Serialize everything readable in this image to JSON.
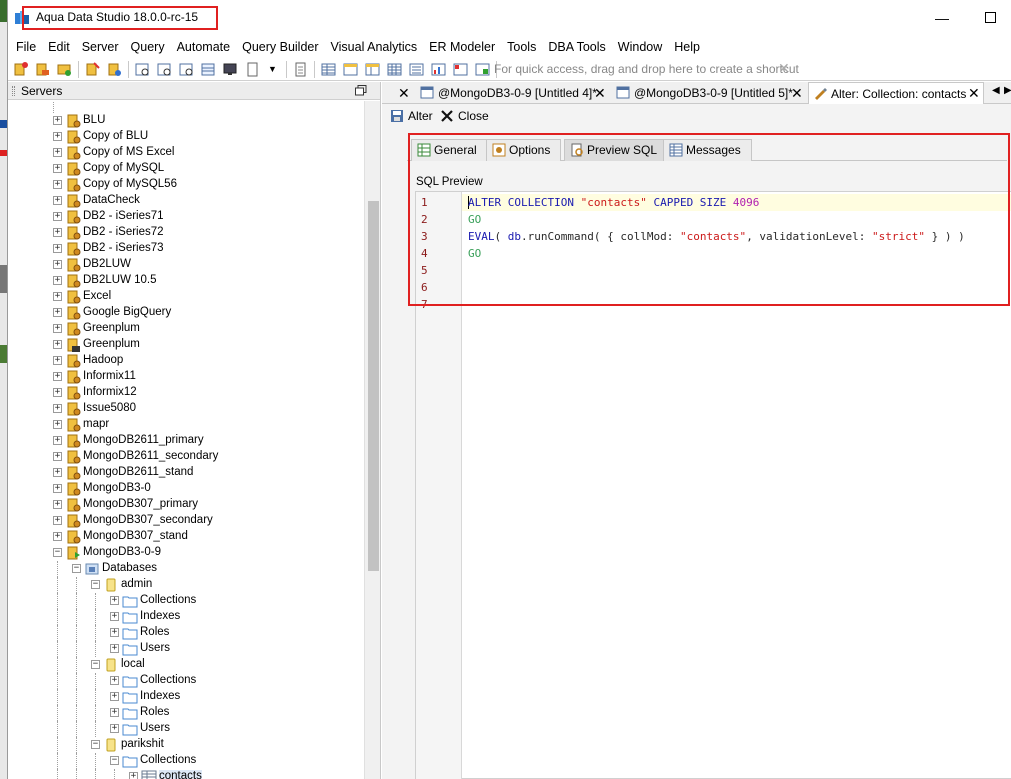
{
  "window": {
    "title": "Aqua Data Studio 18.0.0-rc-15",
    "min_glyph": "—",
    "accent_red": "#e02020"
  },
  "menu": [
    "File",
    "Edit",
    "Server",
    "Query",
    "Automate",
    "Query Builder",
    "Visual Analytics",
    "ER Modeler",
    "Tools",
    "DBA Tools",
    "Window",
    "Help"
  ],
  "toolbar": {
    "shortcut_hint": "For quick access, drag and drop here to create a shortcut",
    "close_glyph": "✕"
  },
  "servers": {
    "label": "Servers",
    "items": [
      "BLU",
      "Copy of BLU",
      "Copy of MS Excel",
      "Copy of MySQL",
      "Copy of MySQL56",
      "DataCheck",
      "DB2 - iSeries71",
      "DB2 - iSeries72",
      "DB2 - iSeries73",
      "DB2LUW",
      "DB2LUW 10.5",
      "Excel",
      "Google BigQuery",
      "Greenplum",
      "Greenplum",
      "Hadoop",
      "Informix11",
      "Informix12",
      "Issue5080",
      "mapr",
      "MongoDB2611_primary",
      "MongoDB2611_secondary",
      "MongoDB2611_stand",
      "MongoDB3-0",
      "MongoDB307_primary",
      "MongoDB307_secondary",
      "MongoDB307_stand",
      "MongoDB3-0-9"
    ],
    "databases_label": "Databases",
    "dbs": [
      {
        "name": "admin",
        "children": [
          "Collections",
          "Indexes",
          "Roles",
          "Users"
        ]
      },
      {
        "name": "local",
        "children": [
          "Collections",
          "Indexes",
          "Roles",
          "Users"
        ]
      },
      {
        "name": "parikshit",
        "children": [
          "Collections"
        ]
      }
    ],
    "leaf": "contacts"
  },
  "tabs": [
    {
      "label": "@MongoDB3-0-9 [Untitled 4]*"
    },
    {
      "label": "@MongoDB3-0-9 [Untitled 5]*"
    },
    {
      "label": "Alter: Collection: contacts"
    }
  ],
  "tab_close": "✕",
  "actions": {
    "alter": "Alter",
    "close": "Close"
  },
  "inner_tabs": [
    "General",
    "Options",
    "Preview SQL",
    "Messages"
  ],
  "sql_preview_label": "SQL Preview",
  "code": {
    "line_numbers": [
      "1",
      "2",
      "3",
      "4",
      "5",
      "6",
      "7"
    ],
    "lines": [
      [
        {
          "t": "ALTER COLLECTION ",
          "c": "kw"
        },
        {
          "t": "\"contacts\"",
          "c": "str"
        },
        {
          "t": " CAPPED SIZE ",
          "c": "kw"
        },
        {
          "t": "4096",
          "c": "num"
        }
      ],
      [
        {
          "t": "GO",
          "c": "go"
        }
      ],
      [
        {
          "t": "EVAL",
          "c": "kw"
        },
        {
          "t": "( ",
          "c": "plain"
        },
        {
          "t": "db",
          "c": "kw"
        },
        {
          "t": ".runCommand( { collMod: ",
          "c": "plain"
        },
        {
          "t": "\"contacts\"",
          "c": "str"
        },
        {
          "t": ", validationLevel: ",
          "c": "plain"
        },
        {
          "t": "\"strict\"",
          "c": "str"
        },
        {
          "t": " } ) )",
          "c": "plain"
        }
      ],
      [
        {
          "t": "GO",
          "c": "go"
        }
      ],
      [],
      [],
      []
    ]
  }
}
